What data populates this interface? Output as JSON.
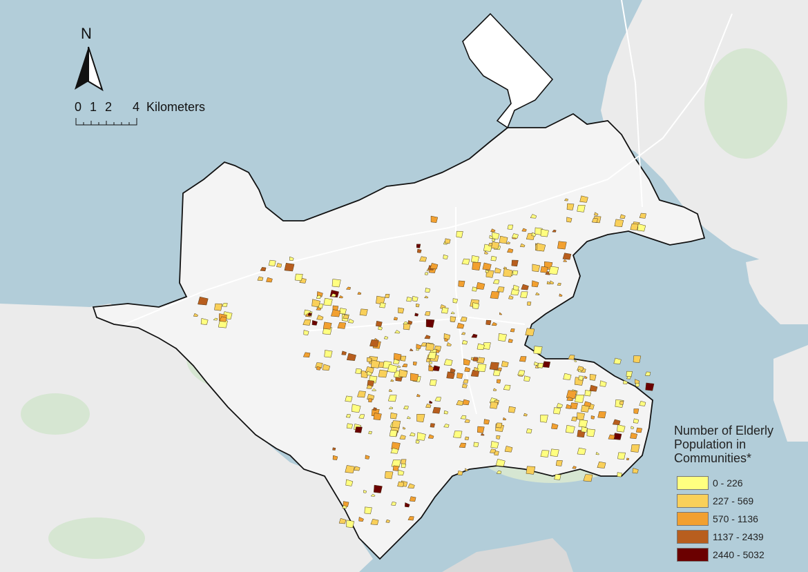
{
  "map": {
    "north_label": "N",
    "scale_bar": {
      "ticks": [
        "0",
        "1",
        "2",
        "4"
      ],
      "unit": "Kilometers"
    },
    "legend": {
      "title": "Number of Elderly\nPopulation in\nCommunities*",
      "classes": [
        {
          "label": "0 - 226",
          "color": "#ffff80"
        },
        {
          "label": "227 - 569",
          "color": "#f9d05a"
        },
        {
          "label": "570 - 1136",
          "color": "#f2a030"
        },
        {
          "label": "1137 - 2439",
          "color": "#b85e1e"
        },
        {
          "label": "2440 - 5032",
          "color": "#6b0000"
        }
      ]
    },
    "colors": {
      "sea": "#b2cdd9",
      "land": "#ebebeb",
      "study_area": "#f4f4f4",
      "greenspace": "#d6e6d2",
      "boundary": "#111111"
    }
  }
}
